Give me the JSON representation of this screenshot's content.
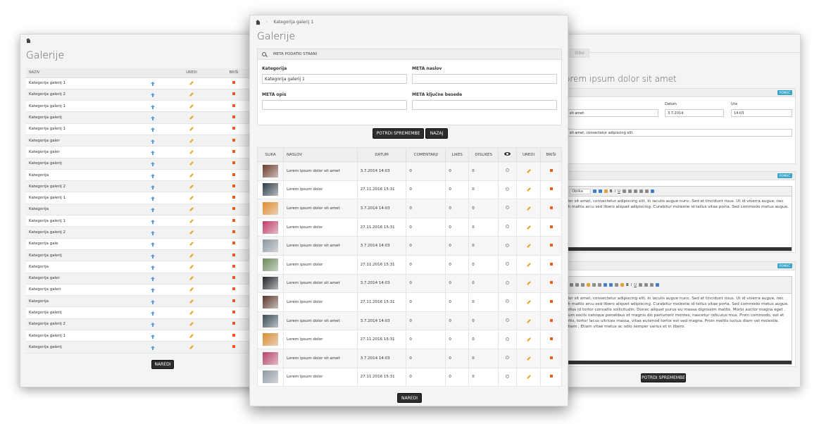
{
  "left": {
    "title": "Galerije",
    "headers": {
      "name": "NAZIV",
      "edit": "UREDI",
      "delete": "BRIŠI"
    },
    "rows": [
      "Kategorija galerij 1",
      "Kategorija galerij 2",
      "Kategorija galerij 1",
      "Kategorija galerij",
      "Kategorija galerij 1",
      "Kategorija galer",
      "Kategorija galer",
      "Kategorija galerij",
      "Kategorija",
      "Kategorija galerij 2",
      "Kategorija galerij 1",
      "Kategorija",
      "Kategorija galerij 1",
      "Kategorija galerij 2",
      "Kategorija gale",
      "Kategorija galerij",
      "Kategorija",
      "Kategorija galer",
      "Kategorija galeri",
      "Kategorija",
      "Kategorija galerij",
      "Kategorija galerij 2",
      "Kategorija galerij 1",
      "Kategorija galerij"
    ],
    "button": "NAREDI"
  },
  "mid": {
    "breadcrumb": "Kategorija galerij 1",
    "title": "Galerije",
    "meta_head": "META PODATKI STRANI",
    "fields": {
      "kategorija_label": "Kategorija",
      "kategorija_value": "Kategorija galerij 1",
      "meta_naslov_label": "META naslov",
      "meta_opis_label": "META opis",
      "meta_kljucne_label": "META ključne besede"
    },
    "buttons": {
      "confirm": "POTRDI SPREMEMBE",
      "back": "NAZAJ",
      "order": "NAREDI"
    },
    "headers": {
      "slika": "SLIKA",
      "naslov": "NASLOV",
      "datum": "DATUM",
      "komentarji": "COMENTARJI",
      "likes": "LIKES",
      "dislikes": "DISLIKES",
      "uredi": "UREDI",
      "brisi": "BRIŠI"
    },
    "rows": [
      {
        "naslov": "Lorem ipsum dolor sit amet",
        "datum": "3.7.2014 14:03",
        "kom": "0",
        "likes": "0",
        "dislikes": "0",
        "thumb": "#6b3a2a"
      },
      {
        "naslov": "Lorem ipsum dolor",
        "datum": "27.11.2016 15:31",
        "kom": "0",
        "likes": "0",
        "dislikes": "0",
        "thumb": "#2c3b47"
      },
      {
        "naslov": "Lorem ipsum dolor sit amet",
        "datum": "3.7.2014 14:03",
        "kom": "0",
        "likes": "0",
        "dislikes": "0",
        "thumb": "#e08a2a"
      },
      {
        "naslov": "Lorem ipsum dolor",
        "datum": "27.11.2016 15:31",
        "kom": "0",
        "likes": "0",
        "dislikes": "0",
        "thumb": "#c23a6a"
      },
      {
        "naslov": "Lorem ipsum dolor sit amet",
        "datum": "3.7.2014 14:03",
        "kom": "0",
        "likes": "0",
        "dislikes": "0",
        "thumb": "#8a96a0"
      },
      {
        "naslov": "Lorem ipsum dolor",
        "datum": "27.11.2016 15:31",
        "kom": "0",
        "likes": "0",
        "dislikes": "0",
        "thumb": "#6a8a5a"
      },
      {
        "naslov": "Lorem ipsum dolor sit amet",
        "datum": "3.7.2014 14:03",
        "kom": "0",
        "likes": "0",
        "dislikes": "0",
        "thumb": "#1e2428"
      },
      {
        "naslov": "Lorem ipsum dolor",
        "datum": "27.11.2016 15:31",
        "kom": "0",
        "likes": "0",
        "dislikes": "0",
        "thumb": "#5a3628"
      },
      {
        "naslov": "Lorem ipsum dolor sit amet",
        "datum": "3.7.2014 14:03",
        "kom": "0",
        "likes": "0",
        "dislikes": "0",
        "thumb": "#3a4a55"
      },
      {
        "naslov": "Lorem ipsum dolor",
        "datum": "27.11.2016 15:31",
        "kom": "0",
        "likes": "0",
        "dislikes": "0",
        "thumb": "#d98a30"
      },
      {
        "naslov": "Lorem ipsum dolor sit amet",
        "datum": "3.7.2014 14:03",
        "kom": "0",
        "likes": "0",
        "dislikes": "0",
        "thumb": "#b8406a"
      },
      {
        "naslov": "Lorem ipsum dolor",
        "datum": "27.11.2016 15:31",
        "kom": "0",
        "likes": "0",
        "dislikes": "0",
        "thumb": "#8e98a2"
      }
    ]
  },
  "right": {
    "tab": "Slike",
    "title": "orem ipsum dolor sit amet",
    "help": "POMOČ",
    "panel1_head": "RI",
    "datum_label": "Datum",
    "ura_label": "Ura",
    "naslov_value": "or sit amet",
    "datum_value": "3.7.2014",
    "ura_value": "14:03",
    "opis_value": "or sit amet, consectetur adipiscing elit.",
    "font_select": "Oblika",
    "editor1_text": "olor sit amet, consectetur adipiscing elit. In iaculis augue nunc. Sed et tincidunt risus. Ut id viverra augue, nec bh mattis arcu sed libero aliquet adipiscing. Curabitur molestie id tellus vitae porta. Sed commodo metus augue.",
    "editor2_text": "olor sit amet, consectetur adipiscing elit. In iaculis augue nunc. Sed et tincidunt risus. Ut id viverra augue, nec bh mattis arcu sed libero aliquet adipiscing. Curabitur molestie id tellus vitae porta. Sed commodo metus augue. tellus id tortor convallis sollicitudin. Donec aliquet purus eu massa dignissim mattis. Morbi auctor magna eget . Cum sociis natoque penatibus et magnis dis parturient montes, nascetur ridiculus mus. Proin commodo, est et ortis, tortor lacus ultrices massa, vitae euismod tortor est sed magna. Proin mattis luctus diam vel molestie. Etiam . Etiam vitae metus ac odio semper varius et in libero.",
    "button": "POTRDI SPREMEMBE"
  }
}
